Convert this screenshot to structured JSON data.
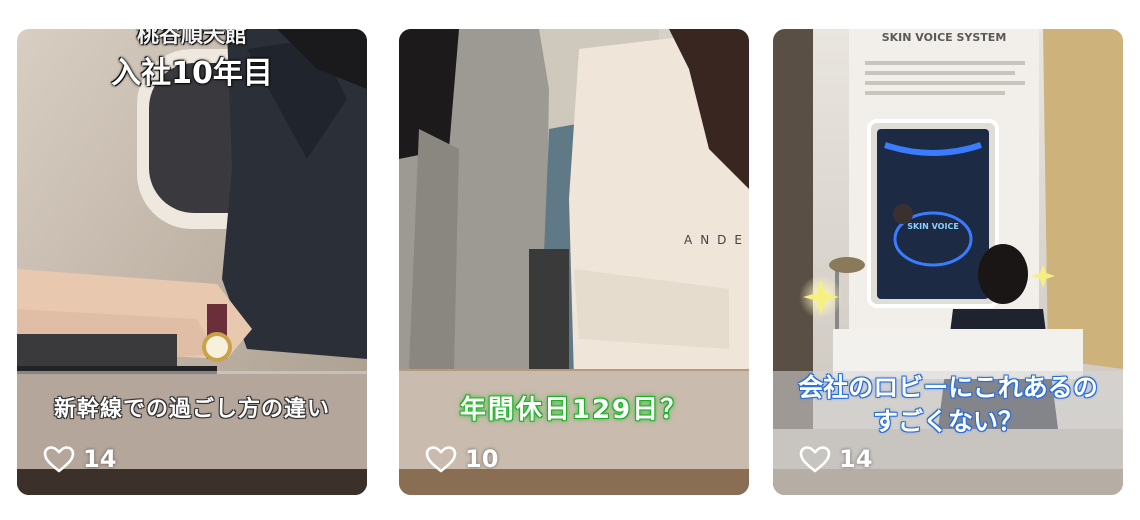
{
  "cards": [
    {
      "top_title": "入社10年目",
      "top_subtitle": "桃谷順天館",
      "caption": "新幹線での過ごし方の違い",
      "likes": "14",
      "icon": "heart-outline-icon"
    },
    {
      "caption": "年間休日129日？",
      "likes": "10",
      "icon": "heart-outline-icon"
    },
    {
      "caption_line1": "会社のロビーにこれあるの",
      "caption_line2": "すごくない？",
      "likes": "14",
      "icon": "heart-outline-icon",
      "panel_header": "SKIN VOICE SYSTEM",
      "screen_text": "SKIN VOICE"
    }
  ],
  "colors": {
    "caption_green_glow": "#22c02a",
    "caption_blue_glow": "#2a78e8",
    "background": "#ffffff"
  }
}
